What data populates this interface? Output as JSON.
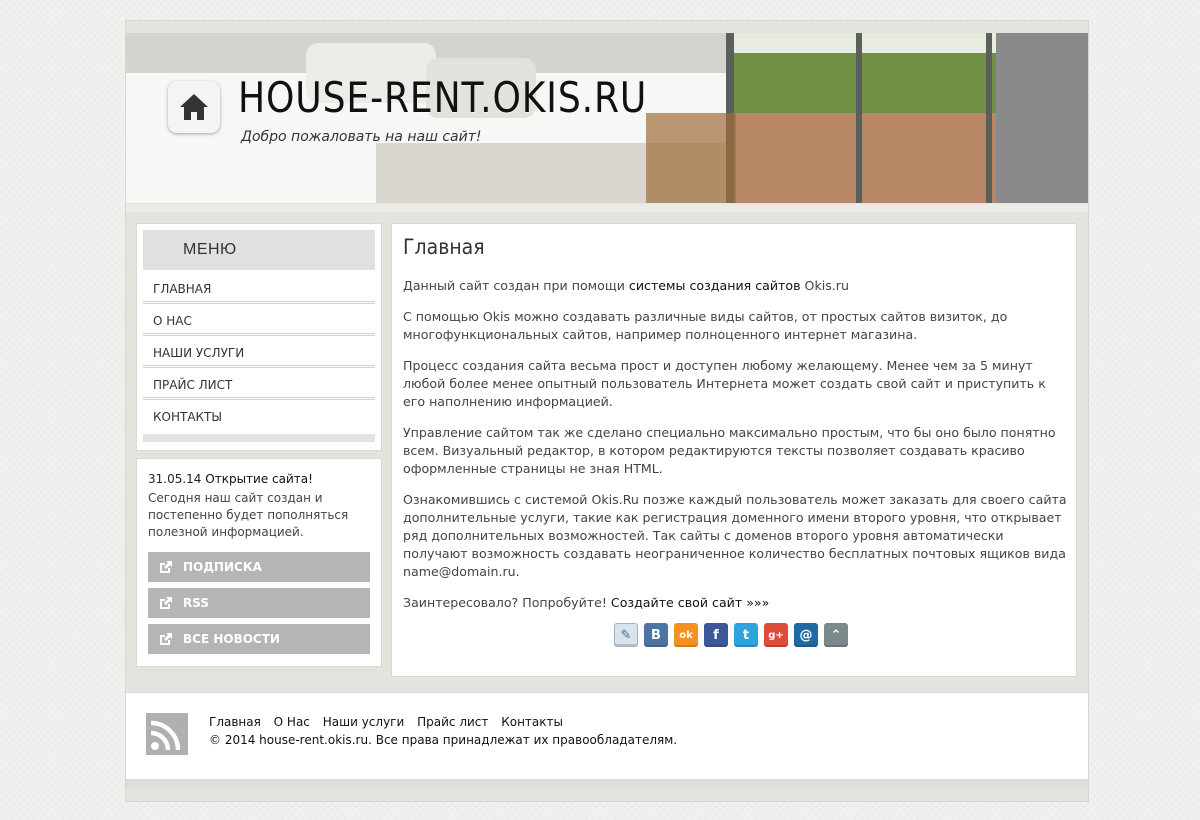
{
  "header": {
    "site_title": "HOUSE-RENT.OKIS.RU",
    "slogan": "Добро пожаловать на наш сайт!",
    "logo_icon": "home-icon"
  },
  "sidebar": {
    "menu_title": "МЕНЮ",
    "items": [
      {
        "label": "ГЛАВНАЯ"
      },
      {
        "label": "О НАС"
      },
      {
        "label": "НАШИ УСЛУГИ"
      },
      {
        "label": "ПРАЙС ЛИСТ"
      },
      {
        "label": "КОНТАКТЫ"
      }
    ]
  },
  "news": {
    "date": "31.05.14",
    "title": "Открытие сайта!",
    "text": "Сегодня наш сайт создан и постепенно будет пополняться полезной информацией.",
    "buttons": [
      {
        "label": "ПОДПИСКА"
      },
      {
        "label": "RSS"
      },
      {
        "label": "ВСЕ НОВОСТИ"
      }
    ]
  },
  "main": {
    "heading": "Главная",
    "p1_prefix": "Данный сайт создан при помощи ",
    "p1_link": "системы создания сайтов",
    "p1_suffix": " Okis.ru",
    "p2": "С помощью Okis можно создавать различные виды сайтов, от простых сайтов визиток, до многофункциональных сайтов, например полноценного интернет магазина.",
    "p3": "Процесс создания сайта весьма прост и доступен любому желающему. Менее чем за 5 минут любой более менее опытный пользователь Интернета может создать свой сайт и приступить к его наполнению информацией.",
    "p4": "Управление сайтом так же сделано специально максимально простым, что бы оно было понятно всем. Визуальный редактор, в котором редактируются тексты позволяет создавать красиво оформленные страницы не зная HTML.",
    "p5": "Ознакомившись с системой Okis.Ru позже каждый пользователь может заказать для своего сайта дополнительные услуги, такие как регистрация доменного имени второго уровня, что открывает ряд дополнительных возможностей. Так сайты с доменов второго уровня автоматически получают возможность создавать неограниченное количество бесплатных почтовых ящиков вида name@domain.ru.",
    "p6_prefix": "Заинтересовало? Попробуйте! ",
    "p6_link": "Создайте свой сайт »»»",
    "share": [
      {
        "name": "livejournal-icon",
        "glyph": "✎",
        "color": "#d9e3ec"
      },
      {
        "name": "vkontakte-icon",
        "glyph": "B",
        "color": "#4c75a3"
      },
      {
        "name": "odnoklassniki-icon",
        "glyph": "ok",
        "color": "#f59022"
      },
      {
        "name": "facebook-icon",
        "glyph": "f",
        "color": "#3b5998"
      },
      {
        "name": "twitter-icon",
        "glyph": "t",
        "color": "#2fa3de"
      },
      {
        "name": "googleplus-icon",
        "glyph": "g+",
        "color": "#dd4b39"
      },
      {
        "name": "mailru-icon",
        "glyph": "@",
        "color": "#1f6aa5"
      },
      {
        "name": "more-icon",
        "glyph": "⌃",
        "color": "#7a8a8a"
      }
    ]
  },
  "footer": {
    "links": [
      "Главная",
      "О Нас",
      "Наши услуги",
      "Прайс лист",
      "Контакты"
    ],
    "copyright": "© 2014 house-rent.okis.ru. Все права принадлежат их правообладателям."
  }
}
